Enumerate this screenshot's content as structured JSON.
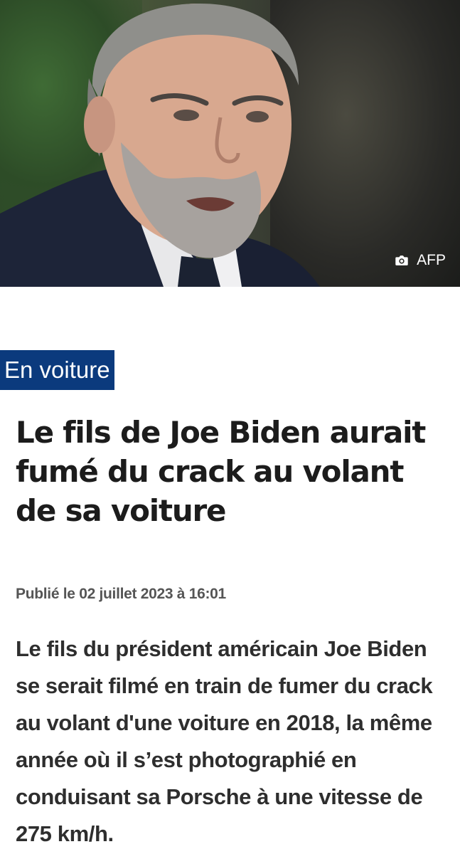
{
  "hero": {
    "photo_credit": "AFP",
    "credit_icon": "camera-icon"
  },
  "article": {
    "category": "En voiture",
    "headline": "Le fils de Joe Biden aurait fumé du crack au volant de sa voiture",
    "published": "Publié le 02 juillet 2023 à 16:01",
    "lede": "Le fils du président américain Joe Biden se serait filmé en train de fumer du crack au volant d'une voiture en 2018, la même année où il s’est photographié en conduisant sa Porsche à une vitesse de 275 km/h."
  },
  "colors": {
    "category_bg": "#0b3a7d",
    "headline_text": "#1c1c1c",
    "meta_text": "#555555"
  }
}
